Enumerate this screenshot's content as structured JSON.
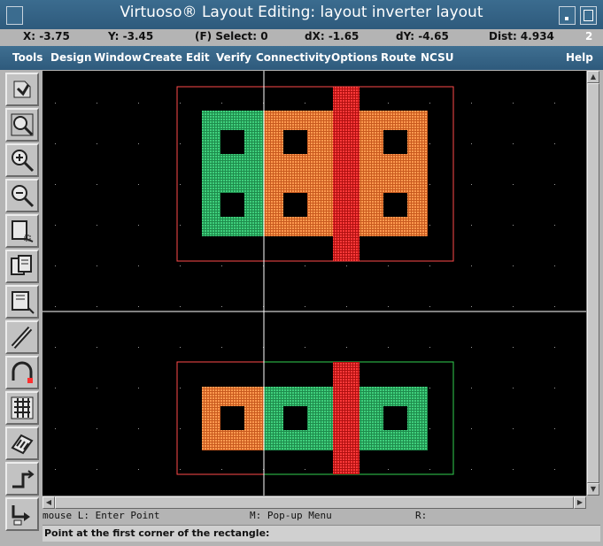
{
  "window": {
    "title": "Virtuoso® Layout Editing: layout inverter layout",
    "window_number": "2"
  },
  "status": {
    "x": "X: -3.75",
    "y": "Y: -3.45",
    "select": "(F) Select: 0",
    "dx": "dX: -1.65",
    "dy": "dY: -4.65",
    "dist": "Dist: 4.934"
  },
  "menu": [
    "Tools",
    "Design",
    "Window",
    "Create",
    "Edit",
    "Verify",
    "Connectivity",
    "Options",
    "Route",
    "NCSU",
    "Help"
  ],
  "toolbar": {
    "icons": [
      "save-icon",
      "zoom-fit-icon",
      "zoom-in-icon",
      "zoom-out-icon",
      "stretch-icon",
      "copy-icon",
      "move-icon",
      "path-icon",
      "arc-icon",
      "hierarchy-icon",
      "instance-icon",
      "ruler-icon",
      "undo-icon"
    ]
  },
  "colors": {
    "canvas": "#000000",
    "oxide": "#2fb86a",
    "implant": "#ff8c3c",
    "poly": "#ff2020",
    "nwell_outline": "#ff4a4a",
    "select_outline": "#32d050",
    "menu_bg": "#30607f"
  },
  "hints": {
    "mouse_l": "mouse L: Enter Point",
    "mouse_m": "M: Pop-up Menu",
    "mouse_r": "R:"
  },
  "prompt": "Point at the first corner of the rectangle:"
}
